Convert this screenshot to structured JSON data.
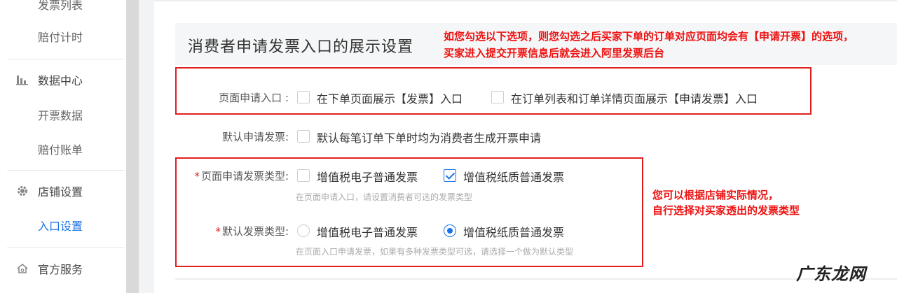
{
  "sidebar": {
    "items": [
      {
        "label": "发票列表"
      },
      {
        "label": "赔付计时"
      },
      {
        "label": "数据中心",
        "icon": "bar-chart-icon"
      },
      {
        "label": "开票数据"
      },
      {
        "label": "赔付账单"
      },
      {
        "label": "店铺设置",
        "icon": "gear-icon"
      },
      {
        "label": "入口设置"
      },
      {
        "label": "官方服务",
        "icon": "home-icon"
      }
    ],
    "active_color": "#1a73e8"
  },
  "panel": {
    "title": "消费者申请发票入口的展示设置",
    "annotation": "如您勾选以下选项，则您勾选之后买家下单的订单对应页面均会有【申请开票】的选项，买家进入提交开票信息后就会进入阿里发票后台"
  },
  "form": {
    "entry": {
      "label": "页面申请入口 :",
      "options": [
        {
          "label": "在下单页面展示【发票】入口",
          "checked": false
        },
        {
          "label": "在订单列表和订单详情页面展示【申请发票】入口",
          "checked": false
        }
      ]
    },
    "default_apply": {
      "label": "默认申请发票:",
      "option": {
        "label": "默认每笔订单下单时均为消费者生成开票申请",
        "checked": false
      }
    },
    "invoice_types": {
      "required": "*",
      "label": "页面申请发票类型:",
      "options": [
        {
          "label": "增值税电子普通发票",
          "checked": false
        },
        {
          "label": "增值税纸质普通发票",
          "checked": true
        }
      ],
      "hint": "在页面申请入口，请设置消费者可选的发票类型"
    },
    "default_type": {
      "required": "*",
      "label": "默认发票类型:",
      "options": [
        {
          "label": "增值税电子普通发票",
          "selected": false
        },
        {
          "label": "增值税纸质普通发票",
          "selected": true
        }
      ],
      "hint": "在页面入口申请发票，如果有多种发票类型可选，请选择一个做为默认类型"
    }
  },
  "annotation2": {
    "line1": "您可以根据店铺实际情况，",
    "line2": "自行选择对买家透出的发票类型"
  },
  "watermark": "广东龙网",
  "colors": {
    "annotation": "#ee1111",
    "box": "#e02020",
    "accent": "#1a73e8"
  }
}
